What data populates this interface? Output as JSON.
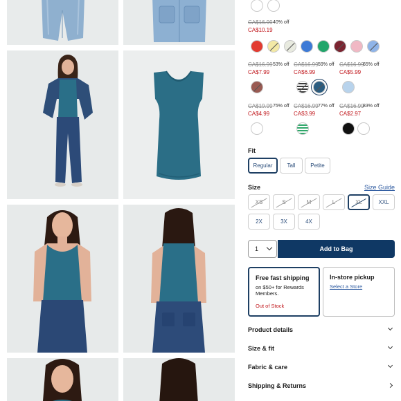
{
  "colors": {
    "accent": "#1e3f63",
    "sale": "#c0161b",
    "button": "#0f3864",
    "link": "#2d5aa0"
  },
  "swatch_groups": [
    {
      "price_old": "CA$16.99",
      "discount": "40% off",
      "price_now": "CA$10.19"
    },
    {
      "price_old": "CA$16.99",
      "discount": "53% off",
      "price_now": "CA$7.99"
    },
    {
      "price_old": "CA$16.99",
      "discount": "59% off",
      "price_now": "CA$6.99"
    },
    {
      "price_old": "CA$16.99",
      "discount": "65% off",
      "price_now": "CA$5.99"
    },
    {
      "price_old": "CA$19.99",
      "discount": "75% off",
      "price_now": "CA$4.99"
    },
    {
      "price_old": "CA$16.99",
      "discount": "77% off",
      "price_now": "CA$3.99"
    },
    {
      "price_old": "CA$16.99",
      "discount": "83% off",
      "price_now": "CA$2.97"
    }
  ],
  "swatches": {
    "row0": [
      "#ffffff",
      "#ffffff"
    ],
    "row1": [
      "#e23b31",
      "#f3e9a6",
      "#e8eadf",
      "#3d7ad6",
      "#22a56b",
      "#7b2430",
      "#f0b8c4",
      "#8fb4e8"
    ],
    "row2": [
      "#9a5a52"
    ],
    "row3": [
      "#4a4a4a",
      "#2a5c80",
      "#b8d3ec"
    ],
    "row4": [
      "#ffffff"
    ],
    "row5": [
      "#2fa76a"
    ],
    "row6": [
      "#111111",
      "#ffffff"
    ]
  },
  "fit": {
    "label": "Fit",
    "options": [
      "Regular",
      "Tall",
      "Petite"
    ],
    "selected": "Regular"
  },
  "size": {
    "label": "Size",
    "guide_label": "Size Guide",
    "options": [
      "XS",
      "S",
      "M",
      "L",
      "XL",
      "XXL",
      "2X",
      "3X",
      "4X"
    ],
    "selected": "XL"
  },
  "quantity": {
    "value": "1"
  },
  "add_to_bag_label": "Add to Bag",
  "shipping": {
    "title": "Free fast shipping",
    "subtitle": "on $50+ for Rewards Members.",
    "status": "Out of Stock"
  },
  "pickup": {
    "title": "In-store pickup",
    "link": "Select a Store"
  },
  "accordions": [
    "Product details",
    "Size & fit",
    "Fabric & care",
    "Shipping & Returns"
  ]
}
